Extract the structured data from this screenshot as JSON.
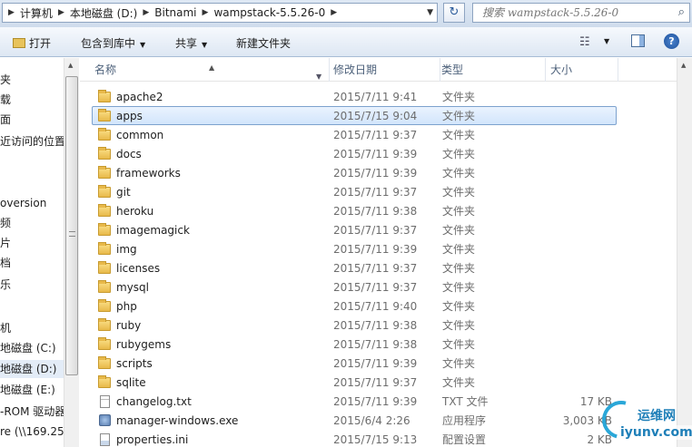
{
  "address": {
    "crumbs": [
      "计算机",
      "本地磁盘 (D:)",
      "Bitnami",
      "wampstack-5.5.26-0"
    ],
    "refresh_glyph": "↻"
  },
  "search": {
    "placeholder": "搜索 wampstack-5.5.26-0",
    "icon": "search-icon"
  },
  "toolbar": {
    "open": "打开",
    "include": "包含到库中",
    "share": "共享",
    "new_folder": "新建文件夹"
  },
  "nav": {
    "items": [
      "夹",
      "载",
      "面",
      "近访问的位置",
      "oversion",
      "频",
      "片",
      "档",
      "乐",
      "机",
      "地磁盘 (C:)",
      "地磁盘 (D:)",
      "地磁盘 (E:)",
      "-ROM 驱动器",
      "re (\\\\169.254"
    ],
    "selected_index": 11
  },
  "columns": {
    "name": "名称",
    "date": "修改日期",
    "type": "类型",
    "size": "大小"
  },
  "files": [
    {
      "name": "apache2",
      "date": "2015/7/11 9:41",
      "type": "文件夹",
      "size": "",
      "kind": "folder"
    },
    {
      "name": "apps",
      "date": "2015/7/15 9:04",
      "type": "文件夹",
      "size": "",
      "kind": "folder",
      "selected": true
    },
    {
      "name": "common",
      "date": "2015/7/11 9:37",
      "type": "文件夹",
      "size": "",
      "kind": "folder"
    },
    {
      "name": "docs",
      "date": "2015/7/11 9:39",
      "type": "文件夹",
      "size": "",
      "kind": "folder"
    },
    {
      "name": "frameworks",
      "date": "2015/7/11 9:39",
      "type": "文件夹",
      "size": "",
      "kind": "folder"
    },
    {
      "name": "git",
      "date": "2015/7/11 9:37",
      "type": "文件夹",
      "size": "",
      "kind": "folder"
    },
    {
      "name": "heroku",
      "date": "2015/7/11 9:38",
      "type": "文件夹",
      "size": "",
      "kind": "folder"
    },
    {
      "name": "imagemagick",
      "date": "2015/7/11 9:37",
      "type": "文件夹",
      "size": "",
      "kind": "folder"
    },
    {
      "name": "img",
      "date": "2015/7/11 9:39",
      "type": "文件夹",
      "size": "",
      "kind": "folder"
    },
    {
      "name": "licenses",
      "date": "2015/7/11 9:37",
      "type": "文件夹",
      "size": "",
      "kind": "folder"
    },
    {
      "name": "mysql",
      "date": "2015/7/11 9:37",
      "type": "文件夹",
      "size": "",
      "kind": "folder"
    },
    {
      "name": "php",
      "date": "2015/7/11 9:40",
      "type": "文件夹",
      "size": "",
      "kind": "folder"
    },
    {
      "name": "ruby",
      "date": "2015/7/11 9:38",
      "type": "文件夹",
      "size": "",
      "kind": "folder"
    },
    {
      "name": "rubygems",
      "date": "2015/7/11 9:38",
      "type": "文件夹",
      "size": "",
      "kind": "folder"
    },
    {
      "name": "scripts",
      "date": "2015/7/11 9:39",
      "type": "文件夹",
      "size": "",
      "kind": "folder"
    },
    {
      "name": "sqlite",
      "date": "2015/7/11 9:37",
      "type": "文件夹",
      "size": "",
      "kind": "folder"
    },
    {
      "name": "changelog.txt",
      "date": "2015/7/11 9:39",
      "type": "TXT 文件",
      "size": "17 KB",
      "kind": "txt"
    },
    {
      "name": "manager-windows.exe",
      "date": "2015/6/4 2:26",
      "type": "应用程序",
      "size": "3,003 KB",
      "kind": "exe"
    },
    {
      "name": "properties.ini",
      "date": "2015/7/15 9:13",
      "type": "配置设置",
      "size": "2 KB",
      "kind": "ini"
    }
  ],
  "watermark": {
    "cn": "运维网",
    "en": "iyunv.com"
  }
}
